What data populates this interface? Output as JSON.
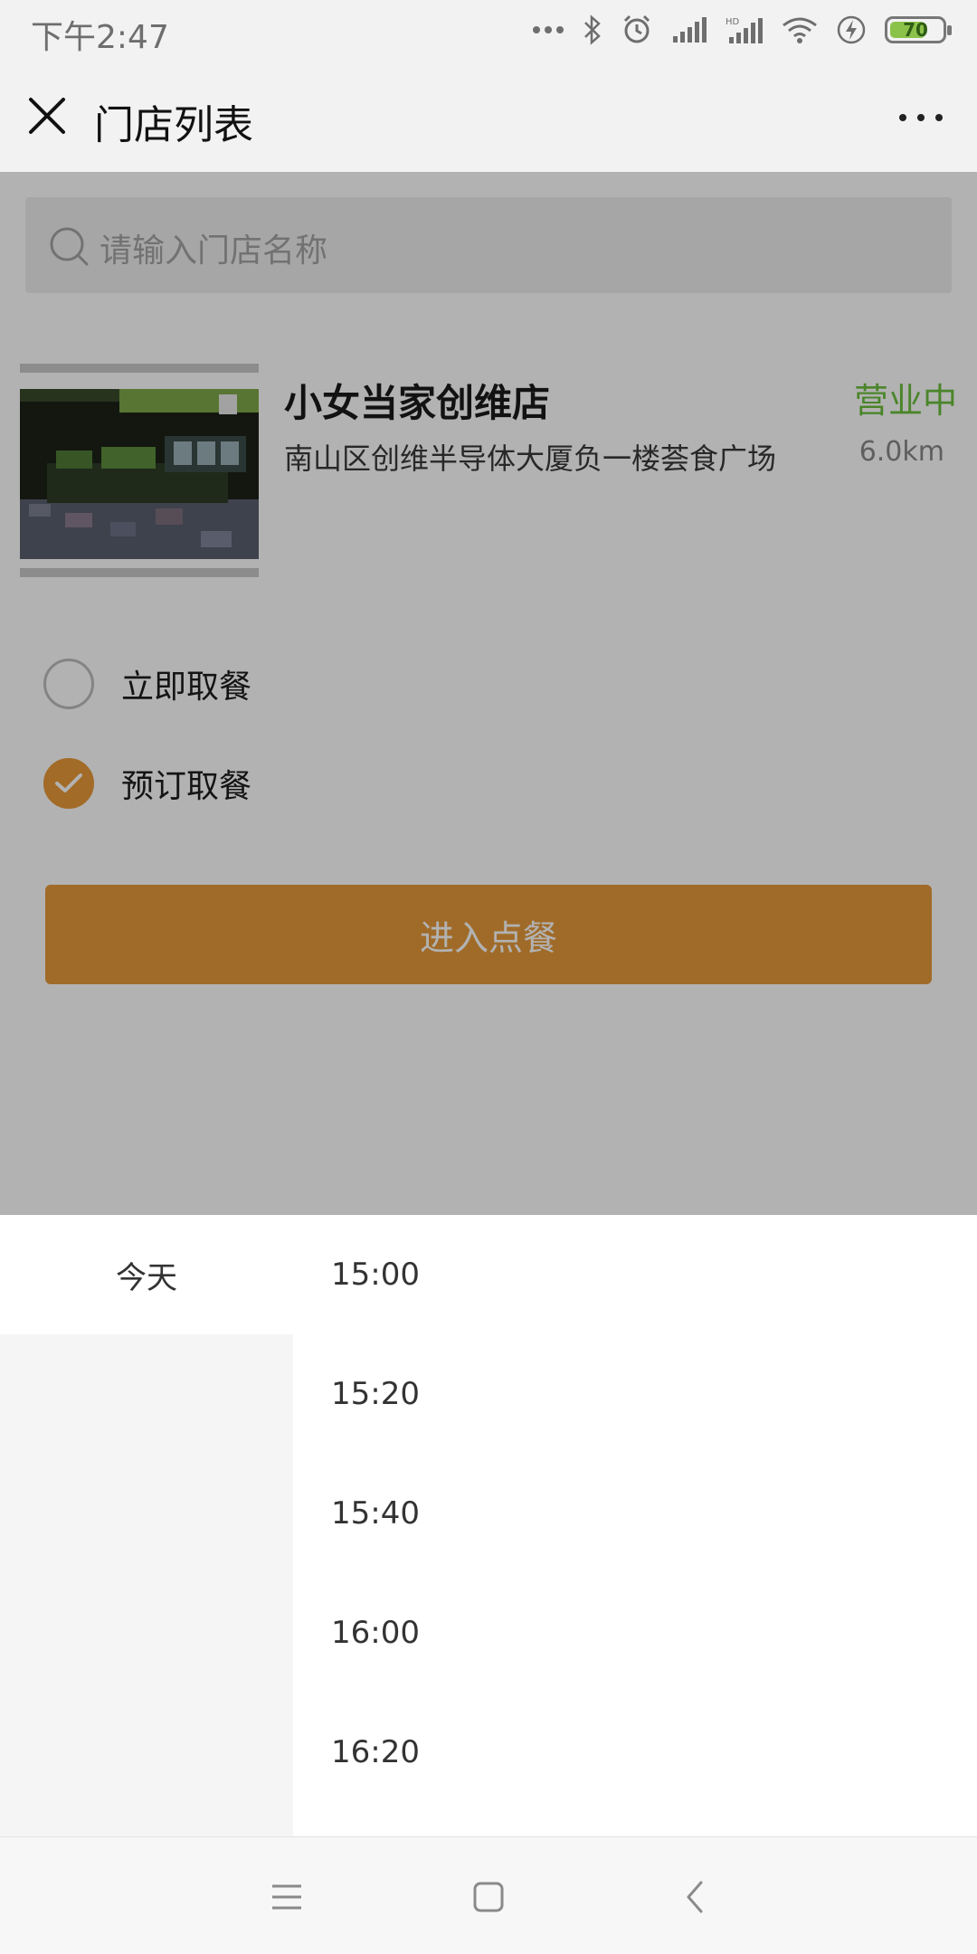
{
  "status_bar": {
    "time": "下午2:47",
    "battery": "70",
    "battery_level": 0.7,
    "icons": [
      "more-dots-icon",
      "bluetooth-icon",
      "alarm-icon",
      "signal-icon",
      "hd-signal-icon",
      "wifi-icon",
      "charging-icon",
      "battery-icon"
    ]
  },
  "header": {
    "title": "门店列表",
    "close_icon": "close-icon",
    "more_icon": "more-icon"
  },
  "search": {
    "placeholder": "请输入门店名称",
    "icon": "search-icon"
  },
  "store": {
    "name": "小女当家创维店",
    "address": "南山区创维半导体大厦负一楼荟食广场",
    "status": "营业中",
    "distance": "6.0km"
  },
  "pickup_options": [
    {
      "label": "立即取餐",
      "selected": false
    },
    {
      "label": "预订取餐",
      "selected": true
    }
  ],
  "enter_button": {
    "label": "进入点餐"
  },
  "picker": {
    "days": [
      {
        "label": "今天",
        "selected": true
      }
    ],
    "times": [
      "15:00",
      "15:20",
      "15:40",
      "16:00",
      "16:20"
    ]
  },
  "nav": {
    "icons": [
      "menu-icon",
      "home-icon",
      "back-icon"
    ]
  },
  "colors": {
    "accent": "#e69a3b",
    "status_green": "#6bbf3d",
    "overlay": "rgba(0,0,0,0.30)"
  }
}
